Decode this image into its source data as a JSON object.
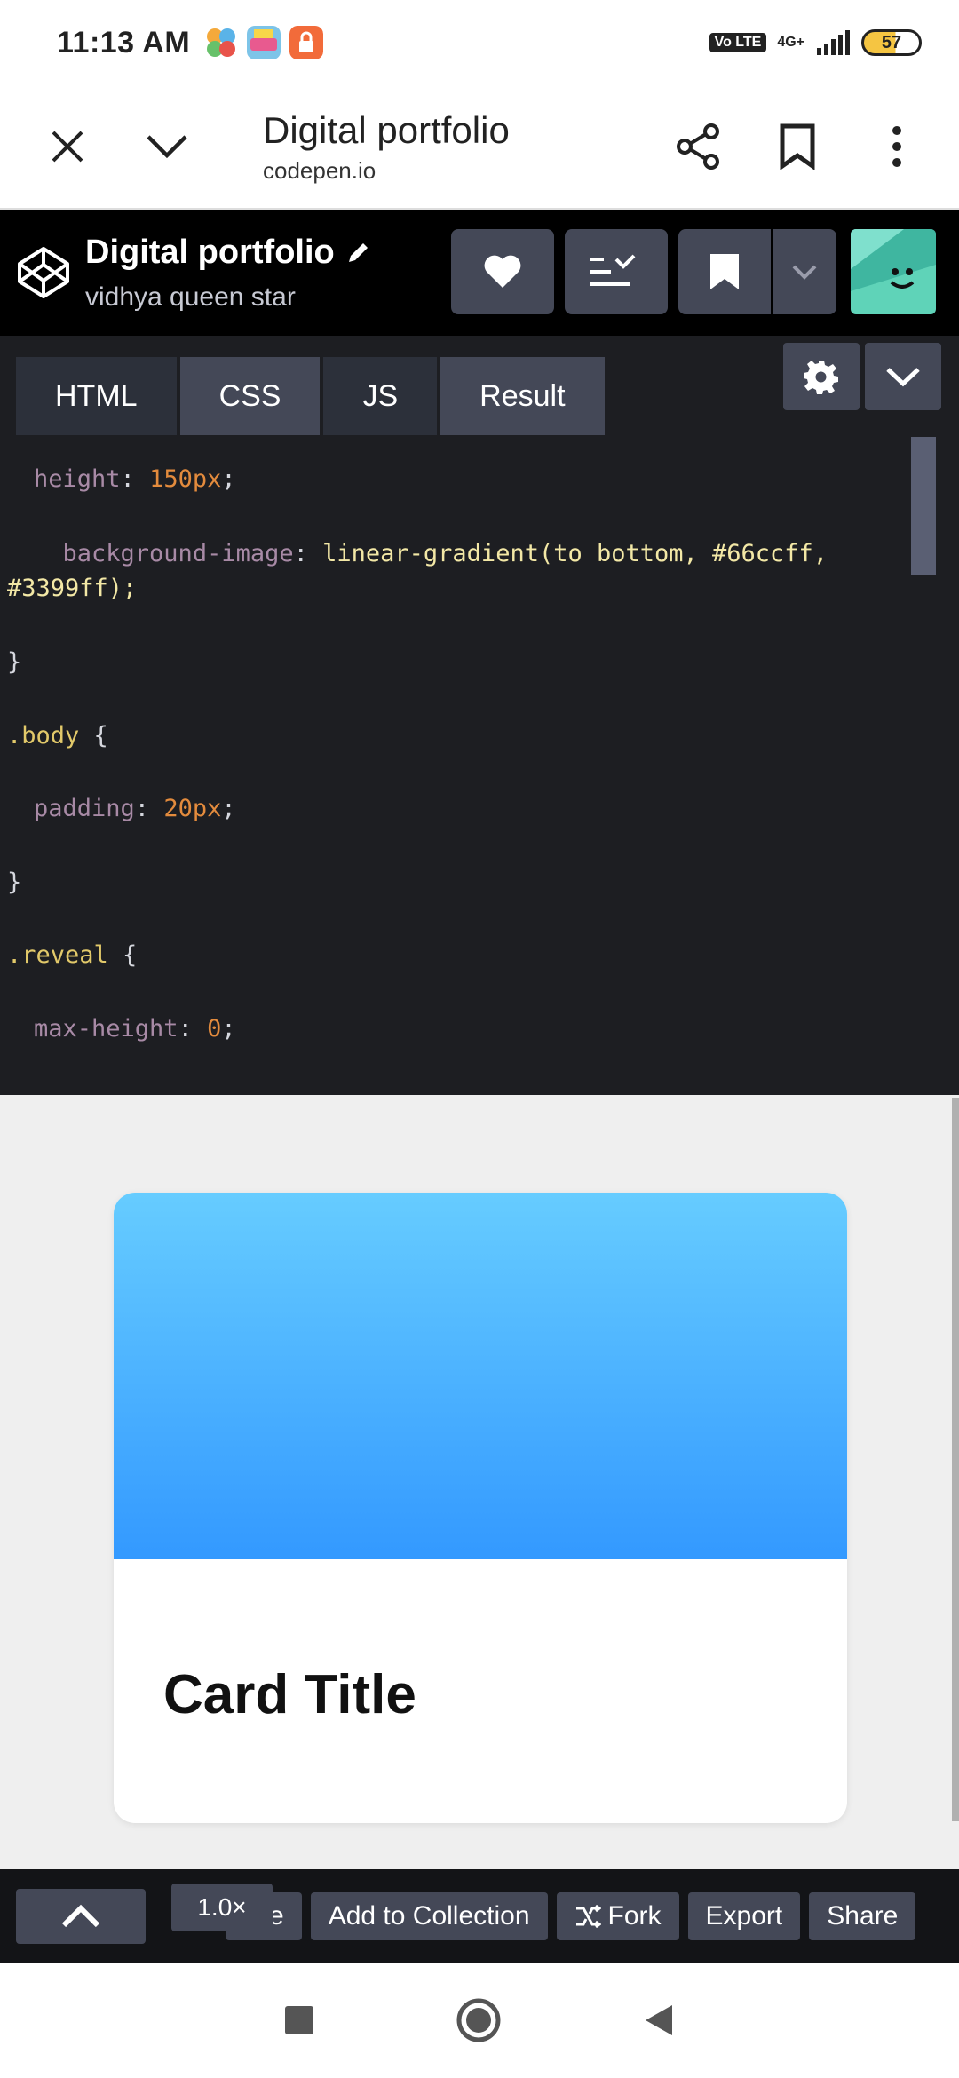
{
  "status_bar": {
    "time": "11:13 AM",
    "network": "4G+",
    "volte": "Vo LTE",
    "battery": "57"
  },
  "browser": {
    "title": "Digital portfolio",
    "url": "codepen.io"
  },
  "codepen": {
    "pen_title": "Digital portfolio",
    "author": "vidhya queen star"
  },
  "editor": {
    "tabs": [
      "HTML",
      "CSS",
      "JS",
      "Result"
    ],
    "active_tab": "CSS",
    "code": {
      "l1_prop": "height",
      "l1_val": "150px",
      "l2_prop": "background-image",
      "l2_val": "linear-gradient(to bottom, #66ccff,",
      "l2_cont": "#3399ff);",
      "l3": "}",
      "l4_sel": ".body",
      "l5_prop": "padding",
      "l5_val": "20px",
      "l6": "}",
      "l7_sel": ".reveal",
      "l8_prop": "max-height",
      "l8_val": "0"
    }
  },
  "result": {
    "card_title": "Card Title",
    "gradient_from": "#66ccff",
    "gradient_to": "#3399ff"
  },
  "toolbar": {
    "zoom": "1.0×",
    "delete_partial": "ete",
    "add_to_collection": "Add to Collection",
    "fork": "Fork",
    "export": "Export",
    "share": "Share"
  },
  "colors": {
    "editor_bg": "#1d1e22",
    "tab_bg": "#2c303a",
    "button_bg": "#444857"
  }
}
